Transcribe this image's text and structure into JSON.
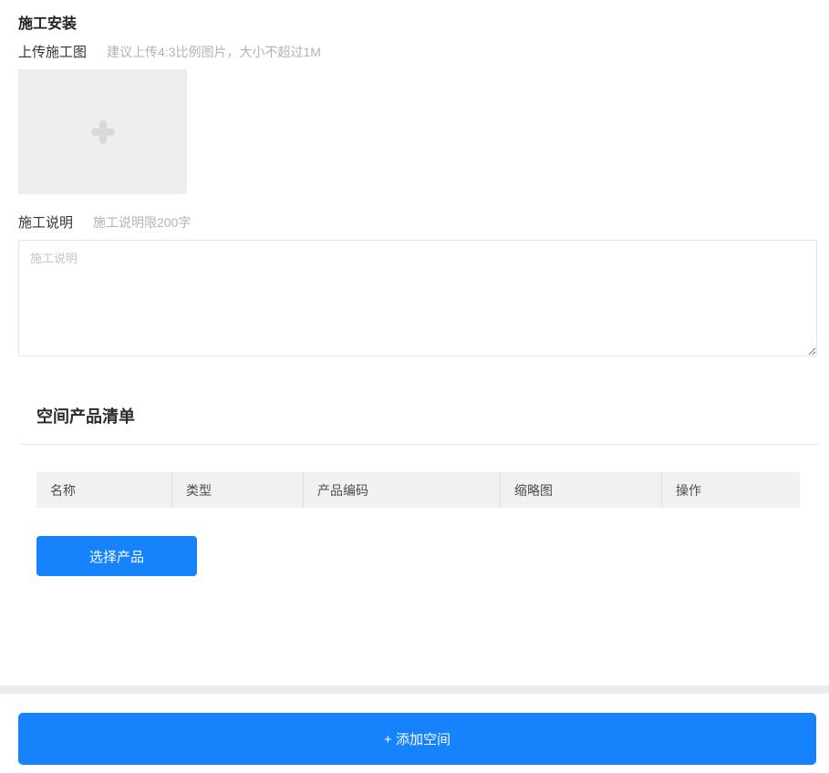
{
  "section": {
    "title": "施工安装"
  },
  "upload": {
    "label": "上传施工图",
    "hint": "建议上传4:3比例图片，大小不超过1M",
    "icon": "plus-icon"
  },
  "description": {
    "label": "施工说明",
    "hint": "施工说明限200字",
    "placeholder": "施工说明",
    "value": ""
  },
  "product_list": {
    "title": "空间产品清单",
    "columns": [
      "名称",
      "类型",
      "产品编码",
      "缩略图",
      "操作"
    ],
    "rows": [],
    "select_button_label": "选择产品"
  },
  "footer": {
    "add_space_button_label": "+ 添加空间"
  },
  "colors": {
    "primary": "#1682fc",
    "table_header_bg": "#f1f1f1",
    "upload_box_bg": "#eeeeee",
    "hint_text": "#b3b3b3"
  }
}
